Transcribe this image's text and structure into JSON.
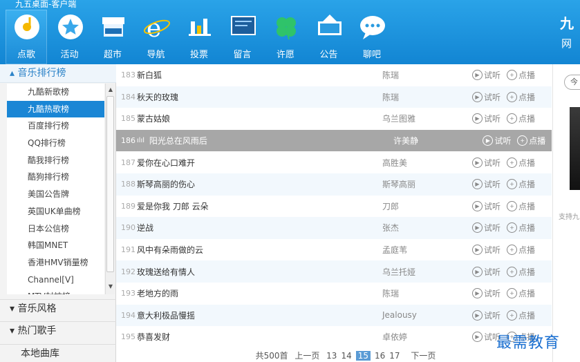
{
  "app": {
    "title": "九五桌面-客户端",
    "brand": "九",
    "brand2": "网"
  },
  "nav": [
    {
      "label": "点歌",
      "icon": "music-disc-icon",
      "active": true
    },
    {
      "label": "活动",
      "icon": "star-badge-icon"
    },
    {
      "label": "超市",
      "icon": "market-icon"
    },
    {
      "label": "导航",
      "icon": "ie-browser-icon"
    },
    {
      "label": "投票",
      "icon": "bar-chart-icon"
    },
    {
      "label": "留言",
      "icon": "message-board-icon"
    },
    {
      "label": "许愿",
      "icon": "clover-icon"
    },
    {
      "label": "公告",
      "icon": "notice-icon"
    },
    {
      "label": "聊吧",
      "icon": "chat-bubble-icon"
    }
  ],
  "sidebar": {
    "section1": "▴ 音乐排行榜",
    "items": [
      "九酷新歌榜",
      "九酷热歌榜",
      "百度排行榜",
      "QQ排行榜",
      "酷我排行榜",
      "酷狗排行榜",
      "美国公告牌",
      "英国UK单曲榜",
      "日本公信榜",
      "韩国MNET",
      "香港HMV销量榜",
      "Channel[V]",
      "MTV封神榜"
    ],
    "selected_index": 1,
    "section2": "▾ 音乐风格",
    "section3": "▾ 热门歌手",
    "section4": "本地曲库"
  },
  "songs": [
    {
      "num": "183",
      "title": "新白狐",
      "artist": "陈瑞"
    },
    {
      "num": "184",
      "title": "秋天的玫瑰",
      "artist": "陈瑞"
    },
    {
      "num": "185",
      "title": "蒙古姑娘",
      "artist": "乌兰图雅"
    },
    {
      "num": "186",
      "title": "阳光总在风雨后",
      "artist": "许美静",
      "playing": true
    },
    {
      "num": "187",
      "title": "爱你在心口难开",
      "artist": "高胜美"
    },
    {
      "num": "188",
      "title": "斯琴高丽的伤心",
      "artist": "斯琴高丽"
    },
    {
      "num": "189",
      "title": "爱是你我 刀郎 云朵",
      "artist": "刀郎"
    },
    {
      "num": "190",
      "title": "逆战",
      "artist": "张杰"
    },
    {
      "num": "191",
      "title": "风中有朵雨做的云",
      "artist": "孟庭苇"
    },
    {
      "num": "192",
      "title": "玫瑰送给有情人",
      "artist": "乌兰托娅"
    },
    {
      "num": "193",
      "title": "老地方的雨",
      "artist": "陈瑞"
    },
    {
      "num": "194",
      "title": "意大利极品慢摇",
      "artist": "Jealousy"
    },
    {
      "num": "195",
      "title": "恭喜发财",
      "artist": "卓依婷"
    }
  ],
  "actions": {
    "listen": "试听",
    "request": "点播"
  },
  "pager": {
    "total": "共500首",
    "prev": "上一页",
    "pages": [
      "13",
      "14",
      "15",
      "16",
      "17"
    ],
    "current": "15",
    "next": "下一页"
  },
  "right": {
    "pill": "今",
    "support": "支持九"
  },
  "watermark": "最需教育"
}
